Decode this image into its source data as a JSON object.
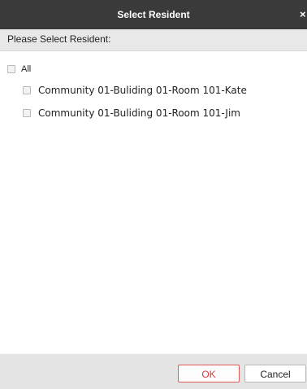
{
  "dialog": {
    "title": "Select Resident",
    "close_glyph": "×"
  },
  "prompt": {
    "label": "Please Select Resident:"
  },
  "tree": {
    "all_label": "All",
    "all_checked": false,
    "items": [
      {
        "label": "Community 01-Buliding 01-Room 101-Kate",
        "checked": false
      },
      {
        "label": "Community 01-Buliding 01-Room 101-Jim",
        "checked": false
      }
    ]
  },
  "footer": {
    "ok_label": "OK",
    "cancel_label": "Cancel"
  },
  "colors": {
    "titlebar": "#3a3a3a",
    "prompt_bg": "#e8e8e8",
    "footer_bg": "#e5e5e5",
    "ok_border": "#e05a5a",
    "ok_text": "#d93a3a"
  },
  "icons": {
    "close": "close-icon",
    "checkbox": "checkbox-icon"
  }
}
